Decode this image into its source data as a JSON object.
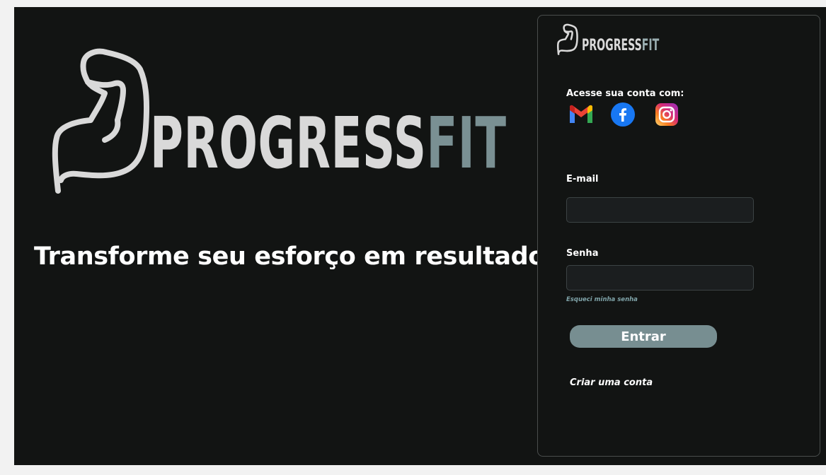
{
  "hero": {
    "brand_part1": "PROGRESS",
    "brand_part2": "FIT",
    "tagline": "Transforme seu esforço em resultado!"
  },
  "card": {
    "brand_part1": "PROGRESS",
    "brand_part2": "FIT",
    "social_label": "Acesse sua conta com:",
    "social": [
      {
        "name": "gmail-icon"
      },
      {
        "name": "facebook-icon"
      },
      {
        "name": "instagram-icon"
      }
    ],
    "email_label": "E-mail",
    "email_value": "",
    "password_label": "Senha",
    "password_value": "",
    "forgot": "Esqueci minha senha",
    "enter_button": "Entrar",
    "create_account": "Criar uma conta"
  },
  "colors": {
    "background": "#121413",
    "brand_light": "#d9d9d9",
    "brand_accent": "#7a9093",
    "button": "#778e91"
  }
}
